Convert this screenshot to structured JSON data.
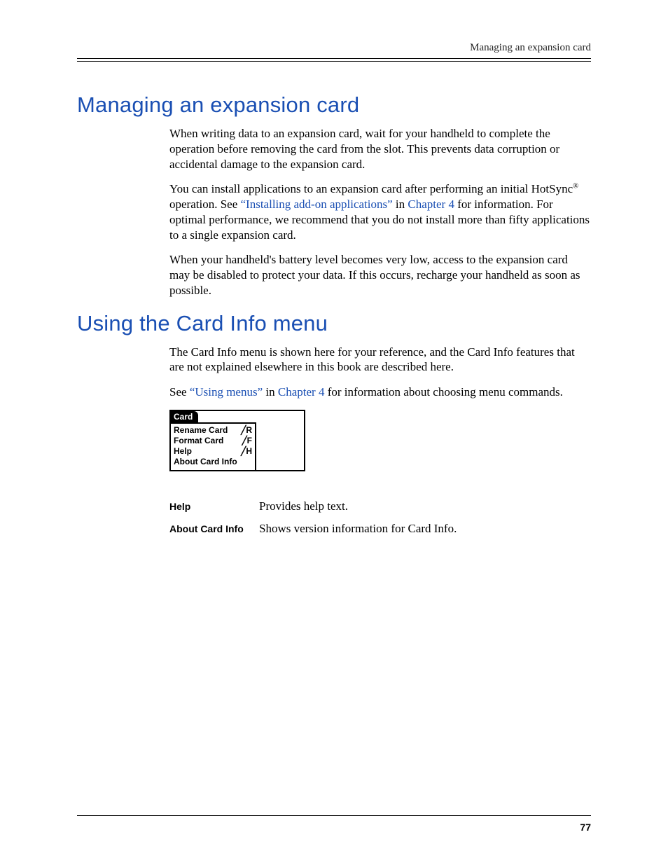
{
  "running_header": "Managing an expansion card",
  "page_number": "77",
  "sections": [
    {
      "heading": "Managing an expansion card",
      "paragraphs": [
        [
          {
            "t": "When writing data to an expansion card, wait for your handheld to complete the operation before removing the card from the slot. This prevents data corruption or accidental damage to the expansion card."
          }
        ],
        [
          {
            "t": "You can install applications to an expansion card after performing an initial HotSync"
          },
          {
            "sup": "®"
          },
          {
            "t": " operation. See "
          },
          {
            "link": "“Installing add-on applications”"
          },
          {
            "t": " in "
          },
          {
            "link": "Chapter 4"
          },
          {
            "t": " for information. For optimal performance, we recommend that you do not install more than fifty applications to a single expansion card."
          }
        ],
        [
          {
            "t": "When your handheld's battery level becomes very low, access to the expansion card may be disabled to protect your data. If this occurs, recharge your handheld as soon as possible."
          }
        ]
      ]
    },
    {
      "heading": "Using the Card Info menu",
      "paragraphs": [
        [
          {
            "t": "The Card Info menu is shown here for your reference, and the Card Info features that are not explained elsewhere in this book are described here."
          }
        ],
        [
          {
            "t": "See "
          },
          {
            "link": "“Using menus”"
          },
          {
            "t": " in "
          },
          {
            "link": "Chapter 4"
          },
          {
            "t": " for information about choosing menu commands."
          }
        ]
      ]
    }
  ],
  "menu": {
    "title": "Card",
    "items": [
      {
        "label": "Rename Card",
        "shortcut": "╱R"
      },
      {
        "label": "Format Card",
        "shortcut": "╱F"
      },
      {
        "label": "Help",
        "shortcut": "╱H"
      },
      {
        "label": "About Card Info",
        "shortcut": ""
      }
    ]
  },
  "definitions": [
    {
      "term": "Help",
      "desc": "Provides help text."
    },
    {
      "term": "About Card Info",
      "desc": "Shows version information for Card Info."
    }
  ]
}
